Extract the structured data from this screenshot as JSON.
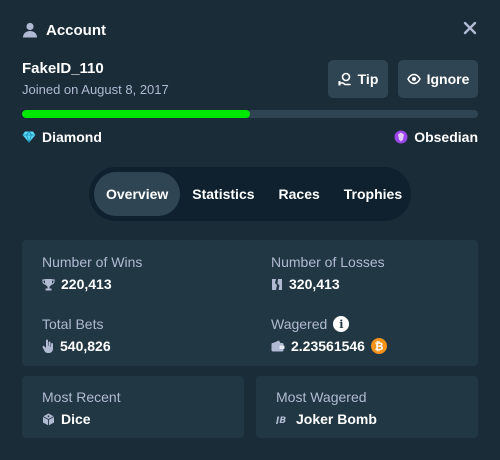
{
  "header": {
    "title": "Account",
    "icon": "user-icon",
    "close_icon": "close-icon"
  },
  "user": {
    "name": "FakeID_110",
    "joined": "Joined on August 8, 2017"
  },
  "actions": {
    "tip_label": "Tip",
    "ignore_label": "Ignore"
  },
  "progress": {
    "fraction": 0.5,
    "color": "#00e701"
  },
  "rank": {
    "current": "Diamond",
    "current_icon": "diamond-icon",
    "next": "Obsedian",
    "next_icon": "obsidian-gem-icon"
  },
  "tabs": [
    {
      "label": "Overview",
      "active": true
    },
    {
      "label": "Statistics",
      "active": false
    },
    {
      "label": "Races",
      "active": false
    },
    {
      "label": "Trophies",
      "active": false
    }
  ],
  "stats": {
    "wins": {
      "label": "Number of Wins",
      "value": "220,413",
      "icon": "trophy-icon"
    },
    "losses": {
      "label": "Number of Losses",
      "value": "320,413",
      "icon": "broken-shield-icon"
    },
    "bets": {
      "label": "Total Bets",
      "value": "540,826",
      "icon": "hand-icon"
    },
    "wagered": {
      "label": "Wagered",
      "value": "2.23561546",
      "icon": "wallet-icon",
      "currency_icon": "bitcoin-icon"
    }
  },
  "recent": {
    "label": "Most Recent",
    "value": "Dice",
    "icon": "dice-icon"
  },
  "most_wagered": {
    "label": "Most Wagered",
    "value": "Joker Bomb",
    "icon": "joker-bomb-icon"
  },
  "colors": {
    "background": "#1a2c38",
    "panel": "#213743",
    "button": "#2f4553",
    "muted_text": "#b1bad3",
    "accent_green": "#00e701",
    "bitcoin": "#f7931a"
  }
}
